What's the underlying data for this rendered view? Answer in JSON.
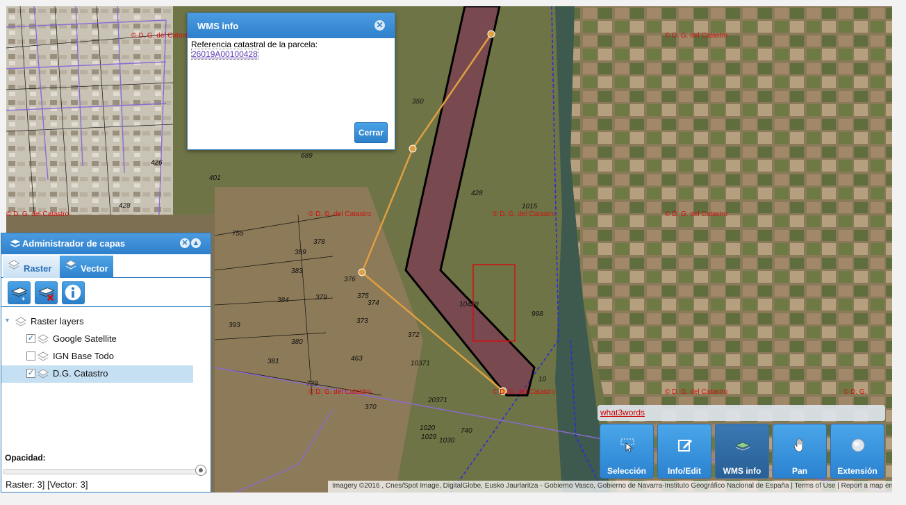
{
  "map": {
    "watermark": "© D. G. del Catastro",
    "parcels": [
      "426",
      "401",
      "428",
      "689",
      "755",
      "378",
      "389",
      "383",
      "384",
      "379",
      "393",
      "380",
      "381",
      "376",
      "375",
      "374",
      "373",
      "372",
      "10371",
      "463",
      "739",
      "370",
      "20371",
      "10428",
      "998",
      "1015",
      "10",
      "1020",
      "1029",
      "1030",
      "740",
      "428",
      "350"
    ]
  },
  "wms_popup": {
    "title": "WMS info",
    "label": "Referencia catastral de la parcela:",
    "reference": "26019A00100428",
    "close_button": "Cerrar"
  },
  "layer_manager": {
    "title": "Administrador de capas",
    "tabs": [
      {
        "label": "Raster"
      },
      {
        "label": "Vector"
      }
    ],
    "tree_root": "Raster layers",
    "layers": [
      {
        "label": "Google Satellite",
        "checked": true
      },
      {
        "label": "IGN Base Todo",
        "checked": false
      },
      {
        "label": "D.G. Catastro",
        "checked": true
      }
    ],
    "opacity_label": "Opacidad:",
    "status": "Raster: 3] [Vector: 3]"
  },
  "what3words": "what3words",
  "toolbar": [
    {
      "label": "Selección",
      "icon": "selection-icon"
    },
    {
      "label": "Info/Edit",
      "icon": "edit-icon"
    },
    {
      "label": "WMS info",
      "icon": "layers-icon"
    },
    {
      "label": "Pan",
      "icon": "hand-icon"
    },
    {
      "label": "Extensión",
      "icon": "globe-icon"
    }
  ],
  "attribution": {
    "imagery": "Imagery ©2016 , Cnes/Spot Image, DigitalGlobe, Eusko Jaurlaritza - Gobierno Vasco, Gobierno de Navarra-Instituto Geográfico Nacional de España",
    "terms": "Terms of Use",
    "report": "Report a map error"
  }
}
